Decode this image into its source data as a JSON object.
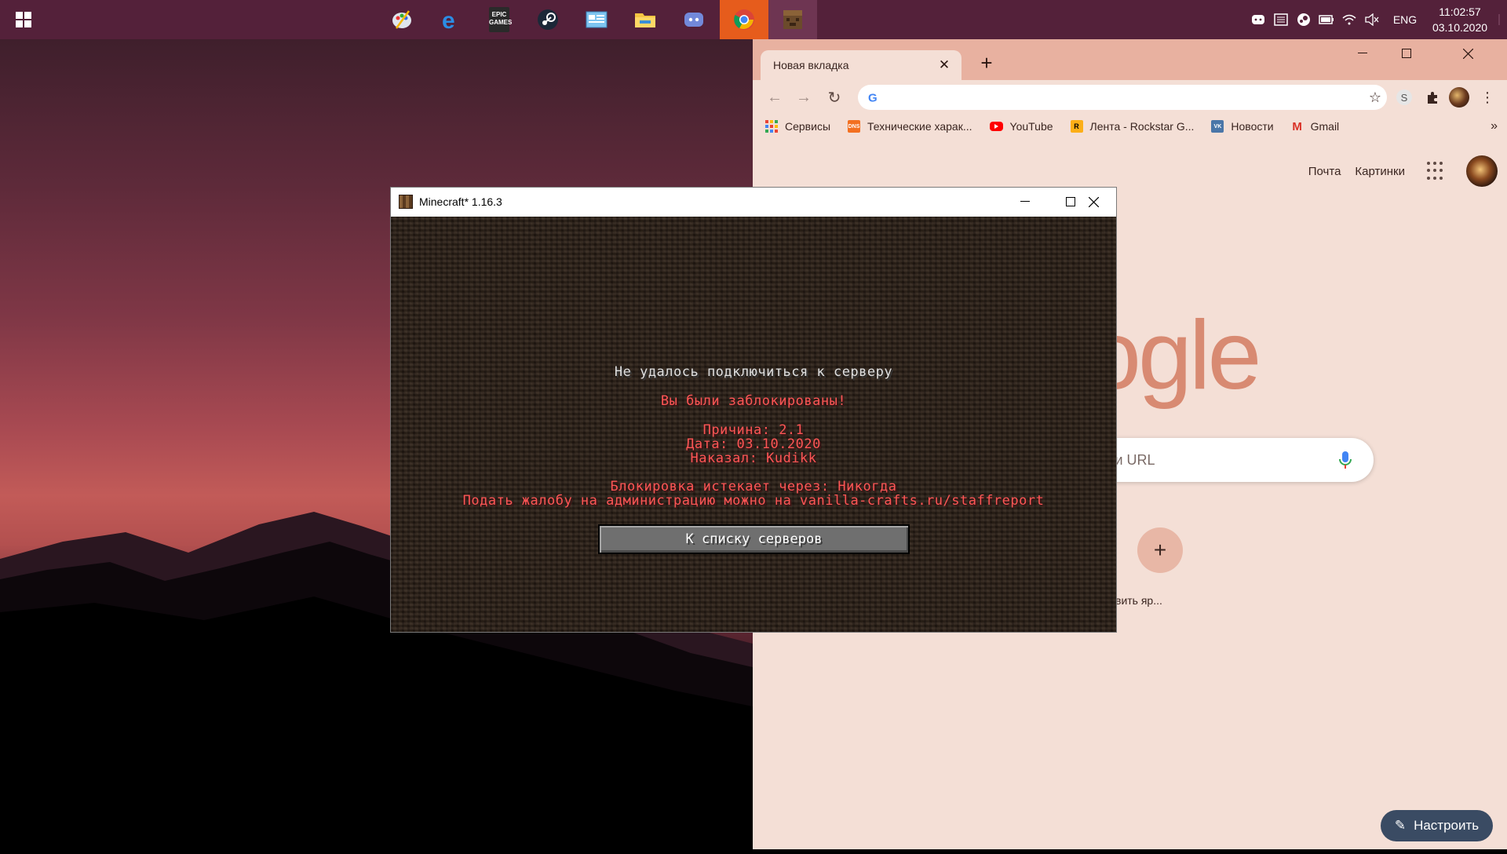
{
  "taskbar": {
    "apps": [
      {
        "name": "paint-app-icon"
      },
      {
        "name": "edge-icon"
      },
      {
        "name": "epic-games-icon",
        "text": "EPIC GAMES"
      },
      {
        "name": "steam-icon"
      },
      {
        "name": "control-panel-icon"
      },
      {
        "name": "file-explorer-icon"
      },
      {
        "name": "discord-icon"
      },
      {
        "name": "chrome-icon"
      },
      {
        "name": "minecraft-icon"
      }
    ],
    "tray": {
      "language": "ENG",
      "time": "11:02:57",
      "date": "03.10.2020"
    }
  },
  "chrome": {
    "tab_title": "Новая вкладка",
    "omnibox_value": "",
    "bookmarks": [
      {
        "label": "Сервисы",
        "icon": "apps-icon"
      },
      {
        "label": "Технические харак...",
        "icon": "dns-icon",
        "icon_text": "DNS",
        "color": "#f37021"
      },
      {
        "label": "YouTube",
        "icon": "youtube-icon",
        "color": "#ff0000"
      },
      {
        "label": "Лента - Rockstar G...",
        "icon": "rockstar-icon",
        "icon_text": "R",
        "color": "#fcaf17"
      },
      {
        "label": "Новости",
        "icon": "vk-icon",
        "icon_text": "VK",
        "color": "#4a76a8"
      },
      {
        "label": "Gmail",
        "icon": "gmail-icon",
        "icon_text": "M",
        "color": "#d93025"
      }
    ],
    "ntp": {
      "mail_link": "Почта",
      "images_link": "Картинки",
      "logo_text": "ogle",
      "search_placeholder": "ли URL",
      "shortcut_add_label": "вить яр...",
      "customize_label": "Настроить"
    },
    "extension_letter": "S"
  },
  "minecraft": {
    "window_title": "Minecraft* 1.16.3",
    "heading": "Не удалось подключиться к серверу",
    "banned": "Вы были заблокированы!",
    "reason": "Причина: 2.1",
    "date": "Дата: 03.10.2020",
    "punished_by": "Наказал: Kudikk",
    "expires": "Блокировка истекает через: Никогда",
    "appeal": "Подать жалобу на администрацию можно на vanilla-crafts.ru/staffreport",
    "button_label": "К списку серверов"
  }
}
